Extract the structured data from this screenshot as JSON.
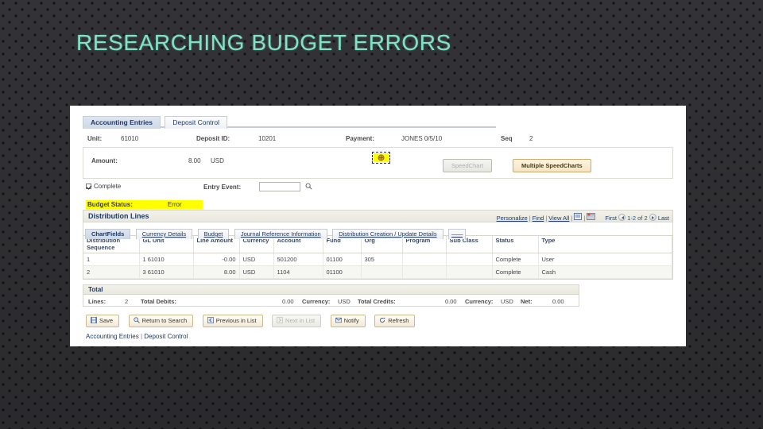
{
  "slide": {
    "title": "RESEARCHING BUDGET ERRORS",
    "title_color": "#7fe3c4",
    "background_color": "#2b2b2e"
  },
  "app": {
    "tabs": [
      {
        "label": "Accounting Entries",
        "active": true
      },
      {
        "label": "Deposit Control",
        "active": false
      }
    ],
    "header_fields": {
      "unit_label": "Unit:",
      "unit_value": "61010",
      "deposit_id_label": "Deposit ID:",
      "deposit_id_value": "10201",
      "payment_label": "Payment:",
      "payment_value": "JONES 0/5/10",
      "seq_label": "Seq",
      "seq_value": "2"
    },
    "amount": {
      "label": "Amount:",
      "value": "8.00",
      "currency": "USD",
      "highlight_color": "#ffff00",
      "speedchart_button": "SpeedChart",
      "multiple_speedcharts_button": "Multiple SpeedCharts"
    },
    "controls": {
      "complete_label": "Complete",
      "complete_checked": true,
      "entry_event_label": "Entry Event:",
      "entry_event_value": "",
      "budget_status_label": "Budget Status:",
      "budget_status_value": "Error",
      "budget_status_highlight": "#ffff00"
    },
    "distribution": {
      "section_title": "Distribution Lines",
      "tools": {
        "personalize": "Personalize",
        "find": "Find",
        "view_all": "View All",
        "first": "First",
        "range": "1-2 of 2",
        "last": "Last"
      },
      "subtabs": [
        {
          "label": "ChartFields",
          "active": true
        },
        {
          "label": "Currency Details",
          "active": false
        },
        {
          "label": "Budget",
          "active": false
        },
        {
          "label": "Journal Reference Information",
          "active": false
        },
        {
          "label": "Distribution Creation / Update Details",
          "active": false
        },
        {
          "label": "——",
          "active": false
        }
      ],
      "columns": [
        "Distribution Sequence",
        "GL Unit",
        "Line Amount",
        "Currency",
        "Account",
        "Fund",
        "Org",
        "Program",
        "Sub Class",
        "Status",
        "Type"
      ],
      "rows": [
        {
          "seq": "1",
          "gl_unit": "1 61010",
          "line_amount": "-0.00",
          "currency": "USD",
          "account": "501200",
          "fund": "01100",
          "org": "305",
          "program": "",
          "sub_class": "",
          "status": "Complete",
          "type": "User"
        },
        {
          "seq": "2",
          "gl_unit": "3 61010",
          "line_amount": "8.00",
          "currency": "USD",
          "account": "1104",
          "fund": "01100",
          "org": "",
          "program": "",
          "sub_class": "",
          "status": "Complete",
          "type": "Cash"
        }
      ]
    },
    "total": {
      "title": "Total",
      "lines_label": "Lines:",
      "lines_value": "2",
      "total_debits_label": "Total Debits:",
      "total_debits_value": "0.00",
      "currency1_label": "Currency:",
      "currency1_value": "USD",
      "total_credits_label": "Total Credits:",
      "total_credits_value": "0.00",
      "currency2_label": "Currency:",
      "currency2_value": "USD",
      "net_label": "Net:",
      "net_value": "0.00"
    },
    "buttons": [
      {
        "label": "Save",
        "disabled": false
      },
      {
        "label": "Return to Search",
        "disabled": false
      },
      {
        "label": "Previous in List",
        "disabled": false
      },
      {
        "label": "Next in List",
        "disabled": true
      },
      {
        "label": "Notify",
        "disabled": false
      },
      {
        "label": "Refresh",
        "disabled": false
      }
    ],
    "footer_links": [
      "Accounting Entries",
      "Deposit Control"
    ]
  }
}
